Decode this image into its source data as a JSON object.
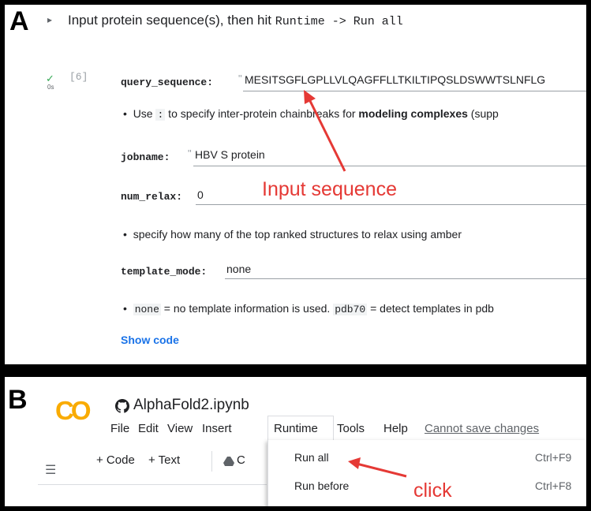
{
  "panel_a": {
    "letter": "A",
    "form_title_prefix": "Input protein sequence(s), then hit ",
    "form_title_code": "Runtime -> Run all",
    "exec_count": "[6]",
    "exec_time": "0s",
    "query_label": "query_sequence:",
    "query_value": "MESITSGFLGPLLVLQAGFFLLTKILTIPQSLDSWWTSLNFLG",
    "note_use_pre": "Use ",
    "note_use_code": ":",
    "note_use_mid": " to specify inter-protein chainbreaks for ",
    "note_use_bold": "modeling complexes",
    "note_use_post": " (supp",
    "jobname_label": "jobname:",
    "jobname_value": "HBV S protein",
    "num_relax_label": "num_relax:",
    "num_relax_value": "0",
    "relax_note": "specify how many of the top ranked structures to relax using amber",
    "template_label": "template_mode:",
    "template_value": "none",
    "template_note_code1": "none",
    "template_note_mid": " = no template information is used. ",
    "template_note_code2": "pdb70",
    "template_note_post": " = detect templates in pdb",
    "show_code": "Show code",
    "annotation": "Input sequence"
  },
  "panel_b": {
    "letter": "B",
    "logo_text": "CO",
    "notebook_name": "AlphaFold2.ipynb",
    "menu": [
      "File",
      "Edit",
      "View",
      "Insert",
      "Runtime",
      "Tools",
      "Help"
    ],
    "cannot_save": "Cannot save changes",
    "toolbar_code": "+ Code",
    "toolbar_text": "+ Text",
    "toolbar_drive_partial": "C",
    "dropdown": [
      {
        "label": "Run all",
        "shortcut": "Ctrl+F9"
      },
      {
        "label": "Run before",
        "shortcut": "Ctrl+F8"
      }
    ],
    "annotation": "click"
  },
  "colors": {
    "annotation": "#e53935",
    "link": "#1a73e8",
    "check": "#34a853",
    "logo_orange": "#f9ab00"
  }
}
